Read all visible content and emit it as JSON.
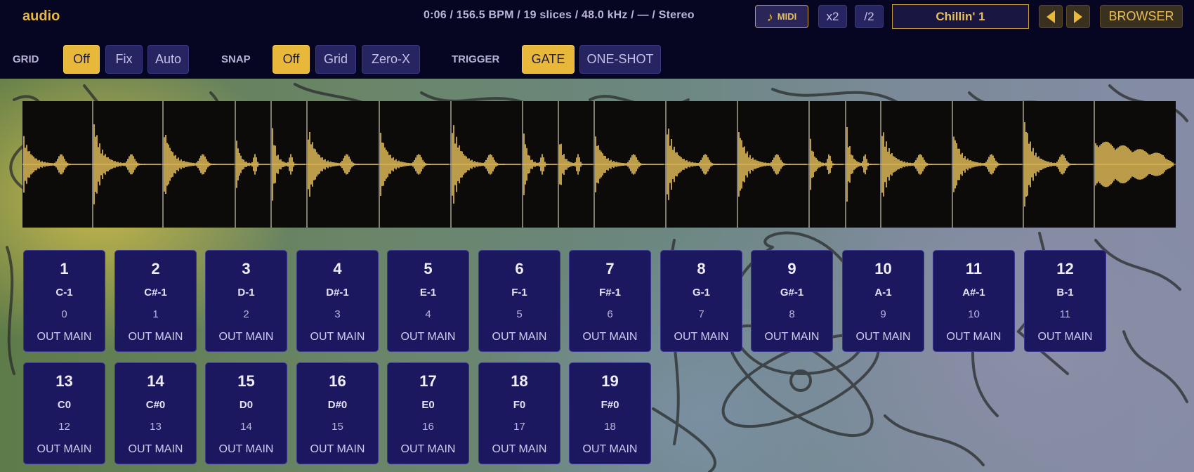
{
  "header": {
    "app_title": "audio",
    "info": "0:06 / 156.5 BPM / 19 slices / 48.0 kHz / — / Stereo",
    "midi_label": "MIDI",
    "x2_label": "x2",
    "div2_label": "/2",
    "preset_name": "Chillin' 1",
    "browser_label": "BROWSER"
  },
  "controls": {
    "grid": {
      "label": "GRID",
      "options": [
        "Off",
        "Fix",
        "Auto"
      ],
      "selected": "Off"
    },
    "snap": {
      "label": "SNAP",
      "options": [
        "Off",
        "Grid",
        "Zero-X"
      ],
      "selected": "Off"
    },
    "trigger": {
      "label": "TRIGGER",
      "options": [
        "GATE",
        "ONE-SHOT"
      ],
      "selected": "GATE"
    }
  },
  "waveform": {
    "slice_count": 19,
    "color": "#e7c05a"
  },
  "pads": [
    {
      "num": "1",
      "note": "C-1",
      "index": "0",
      "out": "OUT MAIN"
    },
    {
      "num": "2",
      "note": "C#-1",
      "index": "1",
      "out": "OUT MAIN"
    },
    {
      "num": "3",
      "note": "D-1",
      "index": "2",
      "out": "OUT MAIN"
    },
    {
      "num": "4",
      "note": "D#-1",
      "index": "3",
      "out": "OUT MAIN"
    },
    {
      "num": "5",
      "note": "E-1",
      "index": "4",
      "out": "OUT MAIN"
    },
    {
      "num": "6",
      "note": "F-1",
      "index": "5",
      "out": "OUT MAIN"
    },
    {
      "num": "7",
      "note": "F#-1",
      "index": "6",
      "out": "OUT MAIN"
    },
    {
      "num": "8",
      "note": "G-1",
      "index": "7",
      "out": "OUT MAIN"
    },
    {
      "num": "9",
      "note": "G#-1",
      "index": "8",
      "out": "OUT MAIN"
    },
    {
      "num": "10",
      "note": "A-1",
      "index": "9",
      "out": "OUT MAIN"
    },
    {
      "num": "11",
      "note": "A#-1",
      "index": "10",
      "out": "OUT MAIN"
    },
    {
      "num": "12",
      "note": "B-1",
      "index": "11",
      "out": "OUT MAIN"
    },
    {
      "num": "13",
      "note": "C0",
      "index": "12",
      "out": "OUT MAIN"
    },
    {
      "num": "14",
      "note": "C#0",
      "index": "13",
      "out": "OUT MAIN"
    },
    {
      "num": "15",
      "note": "D0",
      "index": "14",
      "out": "OUT MAIN"
    },
    {
      "num": "16",
      "note": "D#0",
      "index": "15",
      "out": "OUT MAIN"
    },
    {
      "num": "17",
      "note": "E0",
      "index": "16",
      "out": "OUT MAIN"
    },
    {
      "num": "18",
      "note": "F0",
      "index": "17",
      "out": "OUT MAIN"
    },
    {
      "num": "19",
      "note": "F#0",
      "index": "18",
      "out": "OUT MAIN"
    }
  ],
  "colors": {
    "accent": "#e7b83a",
    "pad_bg": "#1c1860",
    "header_bg": "#060522"
  }
}
